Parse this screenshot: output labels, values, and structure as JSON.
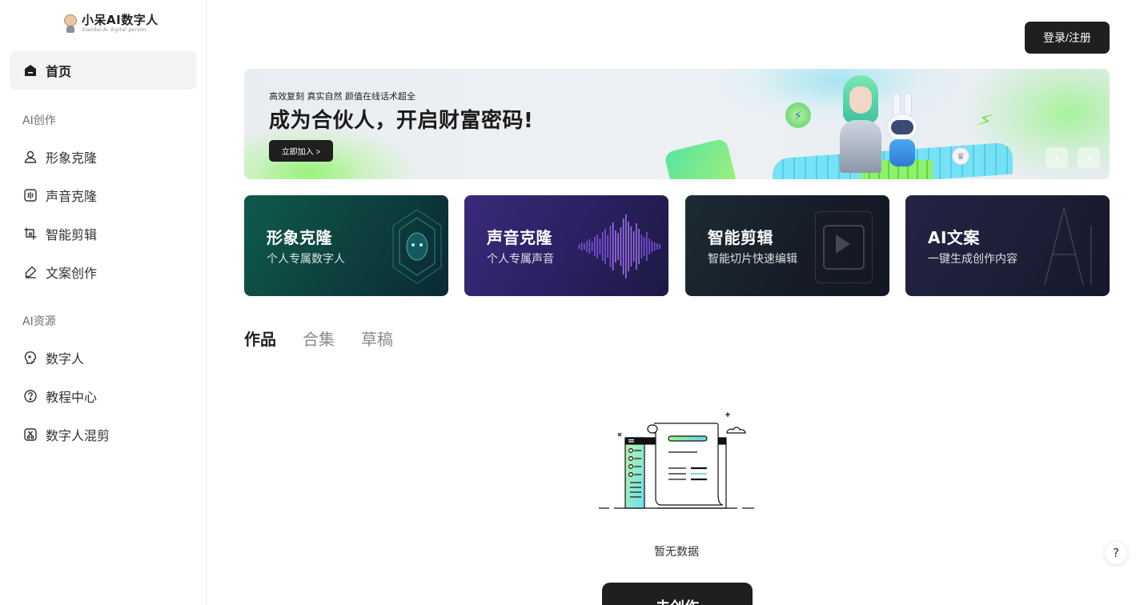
{
  "brand": {
    "title": "小呆AI数字人",
    "subtitle": "Xiaodai-AI digital person"
  },
  "sidebar": {
    "home": {
      "label": "首页",
      "icon": "home-icon"
    },
    "sections": [
      {
        "label": "AI创作",
        "items": [
          {
            "label": "形象克隆",
            "icon": "person-icon"
          },
          {
            "label": "声音克隆",
            "icon": "audio-wave-icon"
          },
          {
            "label": "智能剪辑",
            "icon": "crop-icon"
          },
          {
            "label": "文案创作",
            "icon": "eraser-pen-icon"
          }
        ]
      },
      {
        "label": "AI资源",
        "items": [
          {
            "label": "数字人",
            "icon": "digital-head-icon"
          },
          {
            "label": "教程中心",
            "icon": "question-circle-icon"
          },
          {
            "label": "数字人混剪",
            "icon": "mix-cut-icon"
          }
        ]
      }
    ]
  },
  "header": {
    "login_label": "登录/注册"
  },
  "banner": {
    "tagline": "高效复刻 真实自然 颜值在线话术超全",
    "title": "成为合伙人，开启财富密码!",
    "button_label": "立即加入 >",
    "prev_icon": "chevron-left-icon",
    "next_icon": "chevron-right-icon"
  },
  "cards": [
    {
      "title": "形象克隆",
      "subtitle": "个人专属数字人"
    },
    {
      "title": "声音克隆",
      "subtitle": "个人专属声音"
    },
    {
      "title": "智能剪辑",
      "subtitle": "智能切片快速编辑"
    },
    {
      "title": "AI文案",
      "subtitle": "一键生成创作内容"
    }
  ],
  "tabs": [
    {
      "label": "作品",
      "active": true
    },
    {
      "label": "合集",
      "active": false
    },
    {
      "label": "草稿",
      "active": false
    }
  ],
  "empty_state": {
    "text": "暂无数据",
    "button_label": "去创作"
  },
  "help": {
    "label": "?"
  },
  "colors": {
    "primary_dark": "#1f1f1f",
    "nav_active_bg": "#f1f3f5",
    "accent_green": "#8ff06a",
    "accent_cyan": "#69e0f5"
  }
}
